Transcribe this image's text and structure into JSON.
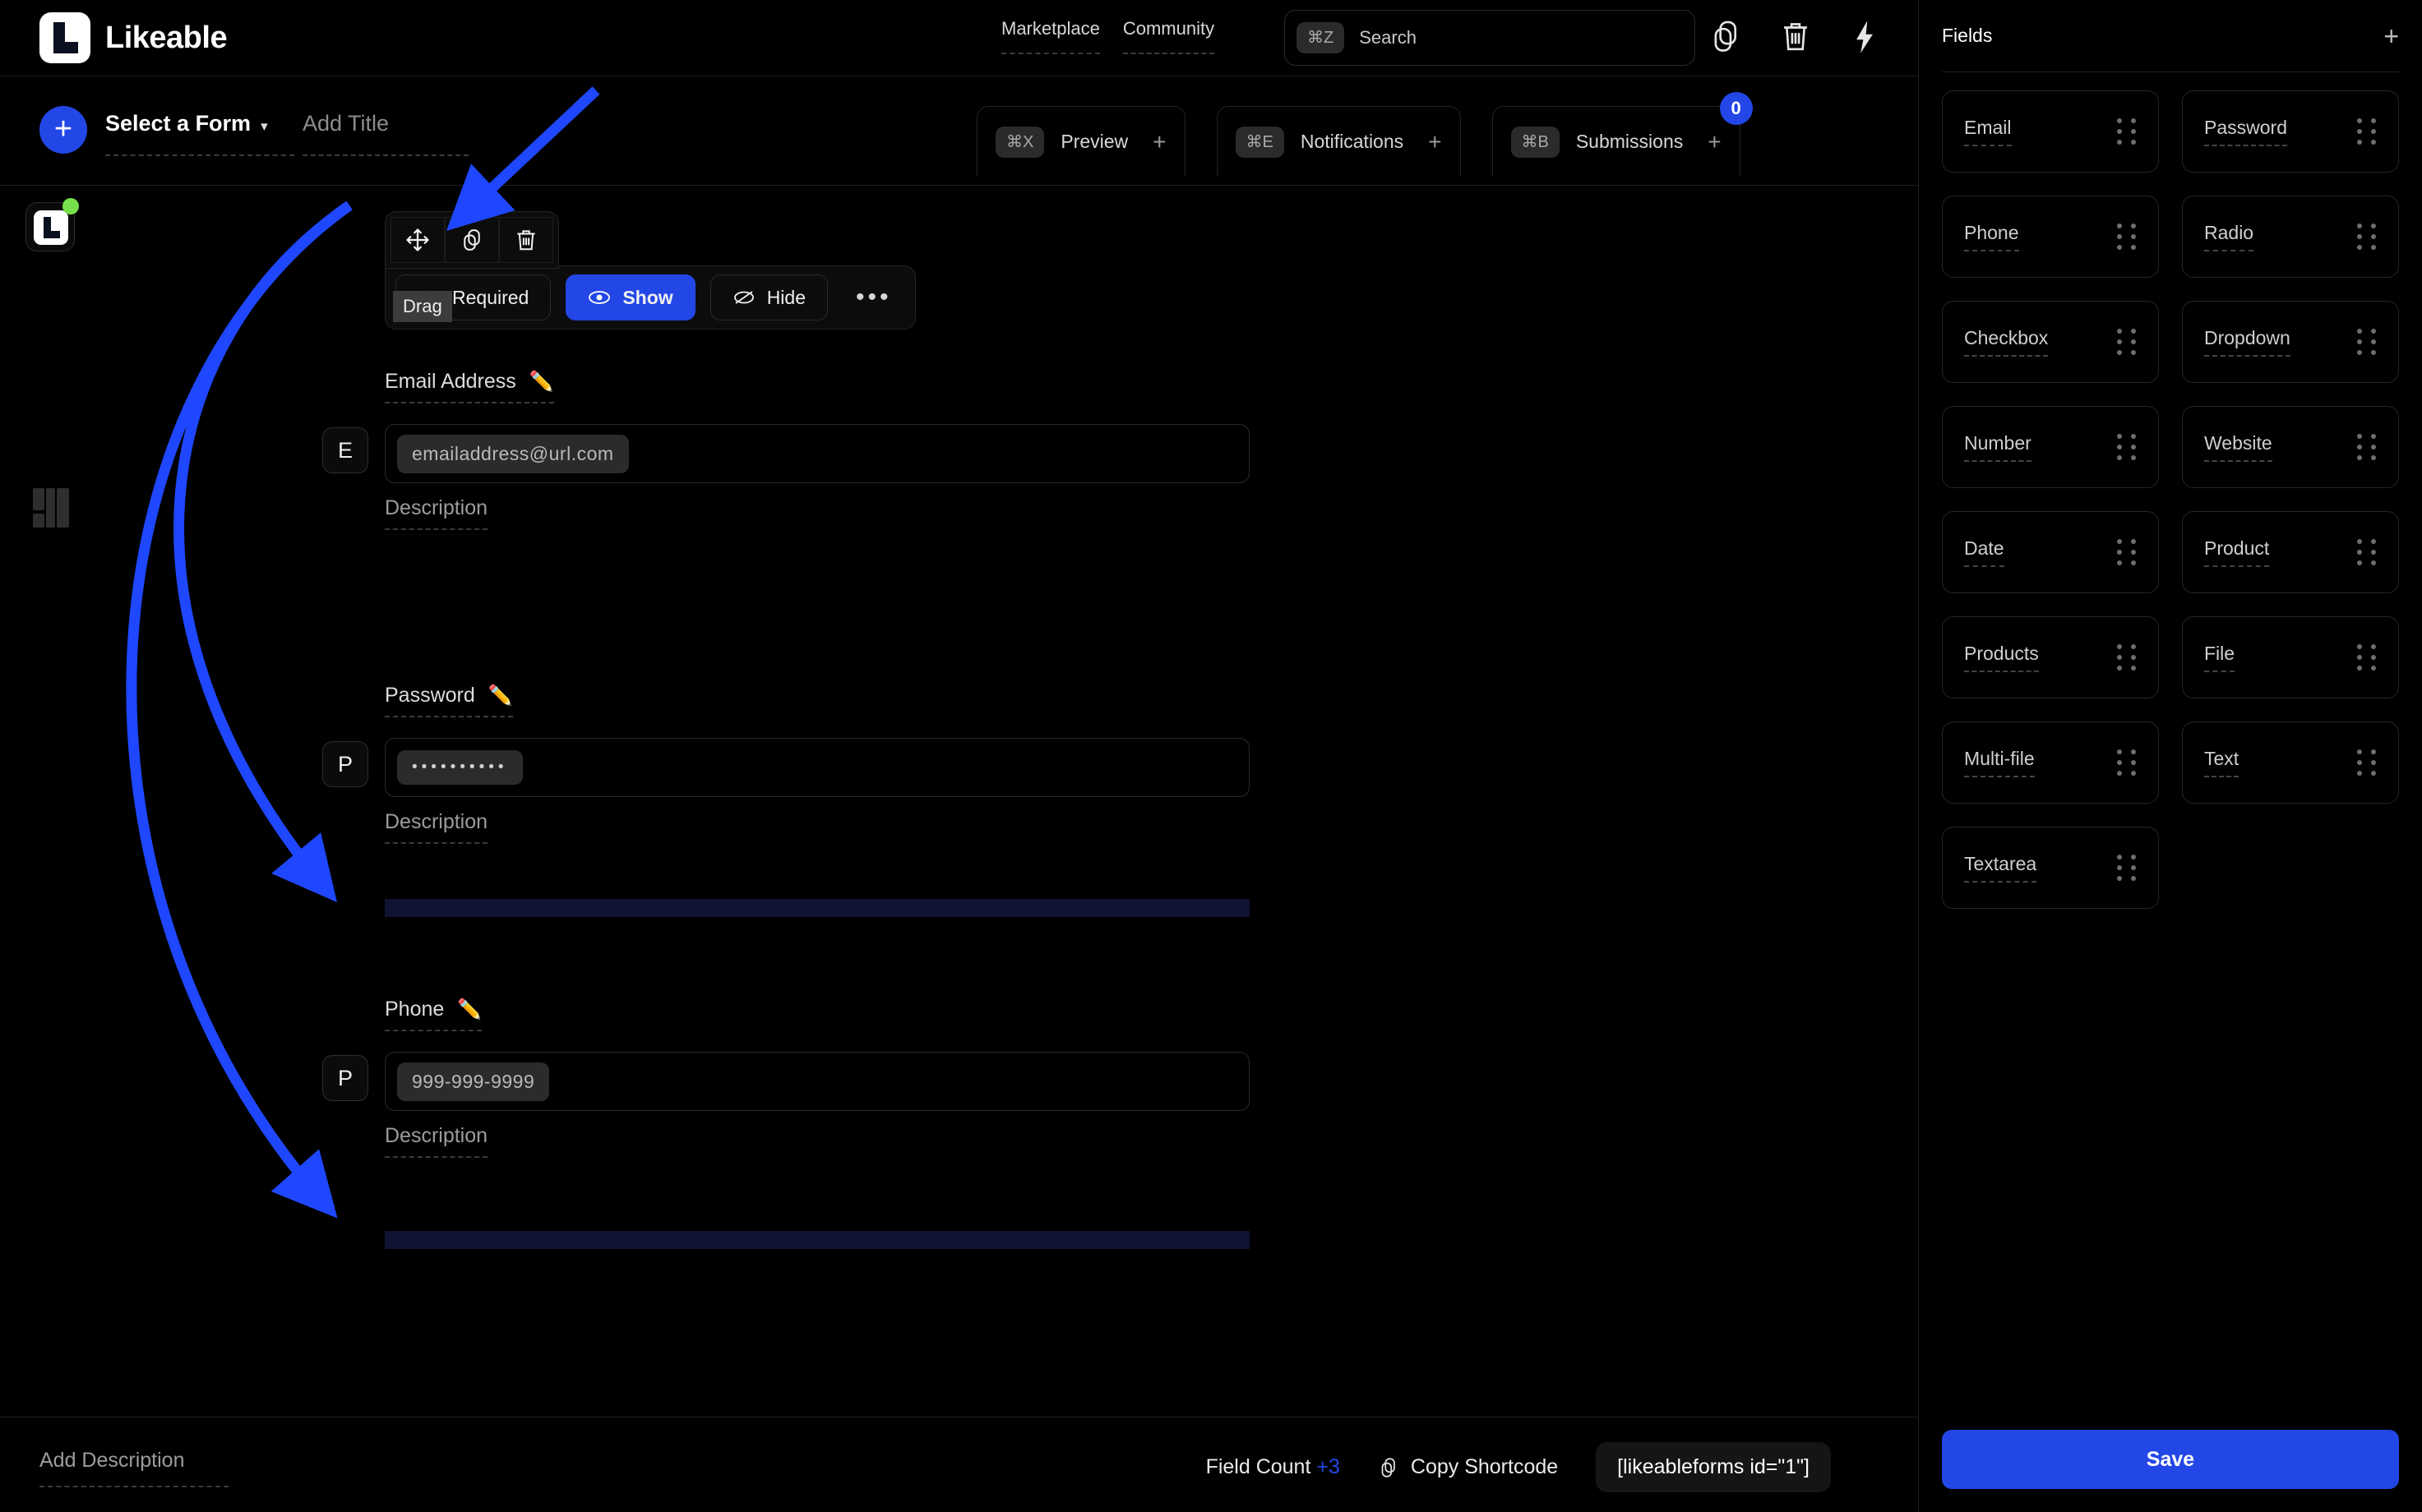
{
  "app": {
    "brand_name": "Likeable",
    "accent_color": "#2347e6",
    "status_dot_color": "#77e04b",
    "dropbar_color": "#0f1433"
  },
  "header": {
    "nav": [
      {
        "label": "Marketplace",
        "icon": "marketplace-link"
      },
      {
        "label": "Community",
        "icon": "community-link"
      }
    ],
    "search": {
      "shortcut": "⌘Z",
      "placeholder": "Search"
    },
    "icons": [
      {
        "name": "copy-icon"
      },
      {
        "name": "trash-icon"
      },
      {
        "name": "lightning-icon"
      }
    ]
  },
  "toolbar": {
    "add_button": "+",
    "form_select_label": "Select a Form",
    "form_select_caret": "▾",
    "title_placeholder": "Add Title",
    "tabs": [
      {
        "shortcut": "⌘X",
        "label": "Preview",
        "plus": "+"
      },
      {
        "shortcut": "⌘E",
        "label": "Notifications",
        "plus": "+"
      },
      {
        "shortcut": "⌘B",
        "label": "Submissions",
        "plus": "+",
        "badge": "0"
      }
    ]
  },
  "field_toolbar": {
    "actions": [
      {
        "name": "drag-icon",
        "label": "Drag"
      },
      {
        "name": "duplicate-icon",
        "label": "Duplicate"
      },
      {
        "name": "delete-icon",
        "label": "Delete"
      }
    ],
    "states": [
      {
        "label": "Required",
        "icon": "asterisk-icon",
        "active": false
      },
      {
        "label": "Show",
        "icon": "eye-icon",
        "active": true
      },
      {
        "label": "Hide",
        "icon": "eye-off-icon",
        "active": false
      }
    ],
    "more": "•••",
    "tooltip": "Drag"
  },
  "form_fields": [
    {
      "label": "Email Address",
      "edit_icon": "✏️",
      "type_badge": "E",
      "value": "emailaddress@url.com",
      "description_placeholder": "Description"
    },
    {
      "label": "Password",
      "edit_icon": "✏️",
      "type_badge": "P",
      "value": "••••••••••",
      "description_placeholder": "Description"
    },
    {
      "label": "Phone",
      "edit_icon": "✏️",
      "type_badge": "P",
      "value": "999-999-9999",
      "description_placeholder": "Description"
    }
  ],
  "fields_panel": {
    "title": "Fields",
    "add_label": "+",
    "items": [
      {
        "label": "Email"
      },
      {
        "label": "Password"
      },
      {
        "label": "Phone"
      },
      {
        "label": "Radio"
      },
      {
        "label": "Checkbox"
      },
      {
        "label": "Dropdown"
      },
      {
        "label": "Number"
      },
      {
        "label": "Website"
      },
      {
        "label": "Date"
      },
      {
        "label": "Product"
      },
      {
        "label": "Products"
      },
      {
        "label": "File"
      },
      {
        "label": "Multi-file"
      },
      {
        "label": "Text"
      },
      {
        "label": "Textarea"
      }
    ],
    "save_label": "Save"
  },
  "footer": {
    "description_placeholder": "Add Description",
    "field_count_label": "Field Count",
    "field_count_value": "+3",
    "copy_shortcode_label": "Copy Shortcode",
    "shortcode": "[likeableforms id=\"1\"]"
  }
}
